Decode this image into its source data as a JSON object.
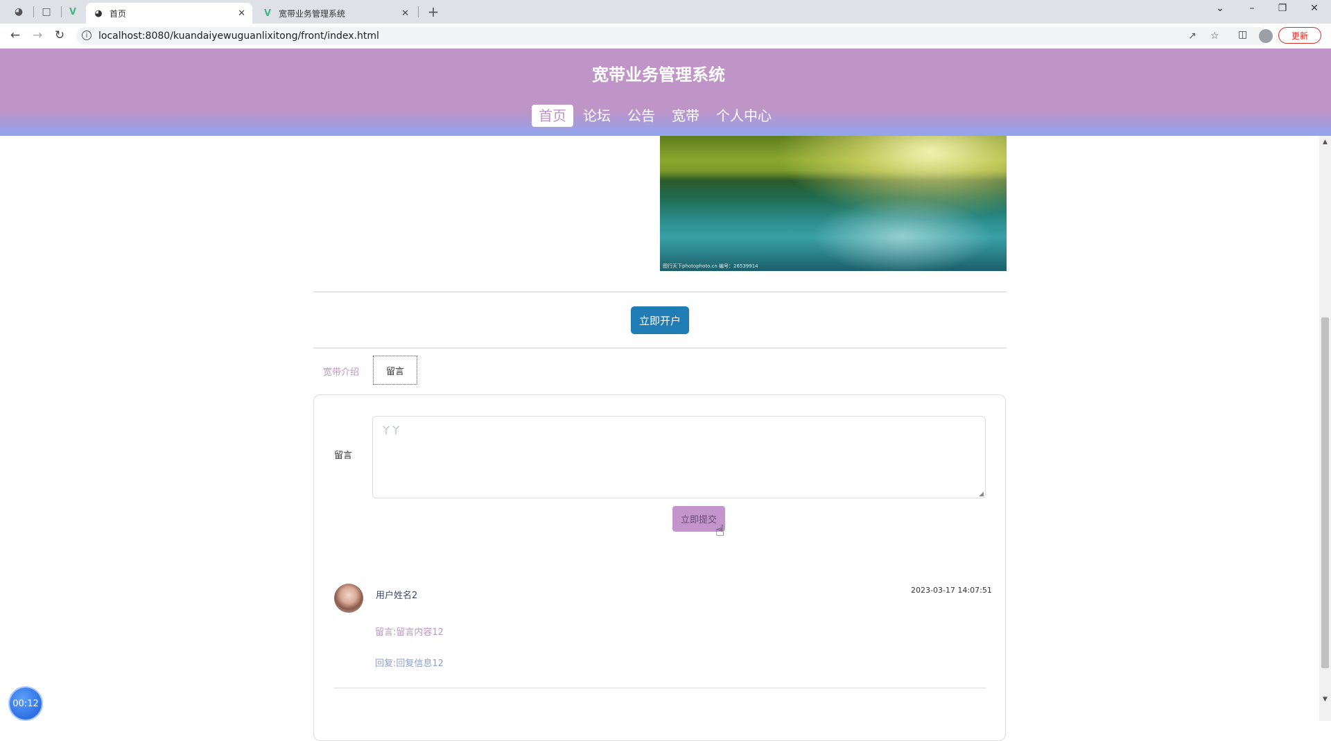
{
  "browser": {
    "tabs": [
      {
        "title": "首页",
        "active": true
      },
      {
        "title": "宽带业务管理系统",
        "active": false
      }
    ],
    "url": "localhost:8080/kuandaiyewuguanlixitong/front/index.html",
    "update_label": "更新"
  },
  "site": {
    "title": "宽带业务管理系统",
    "nav": [
      "首页",
      "论坛",
      "公告",
      "宽带",
      "个人中心"
    ],
    "active_nav": "首页"
  },
  "hero": {
    "watermark": "图行天下photophoto.cn  编号：26539914"
  },
  "open_button": "立即开户",
  "tabs": {
    "intro": "宽带介绍",
    "message": "留言"
  },
  "form": {
    "label": "留言",
    "input_value": "丫丫",
    "submit": "立即提交"
  },
  "comments": [
    {
      "user": "用户姓名2",
      "time": "2023-03-17 14:07:51",
      "content": "留言:留言内容12",
      "reply": "回复:回复信息12"
    }
  ],
  "timer": "00:12",
  "colors": {
    "header": "#bf94c6",
    "header_bottom": "#8fa6ef",
    "open_button": "#1f7cb5",
    "submit_button": "#c495cc"
  }
}
